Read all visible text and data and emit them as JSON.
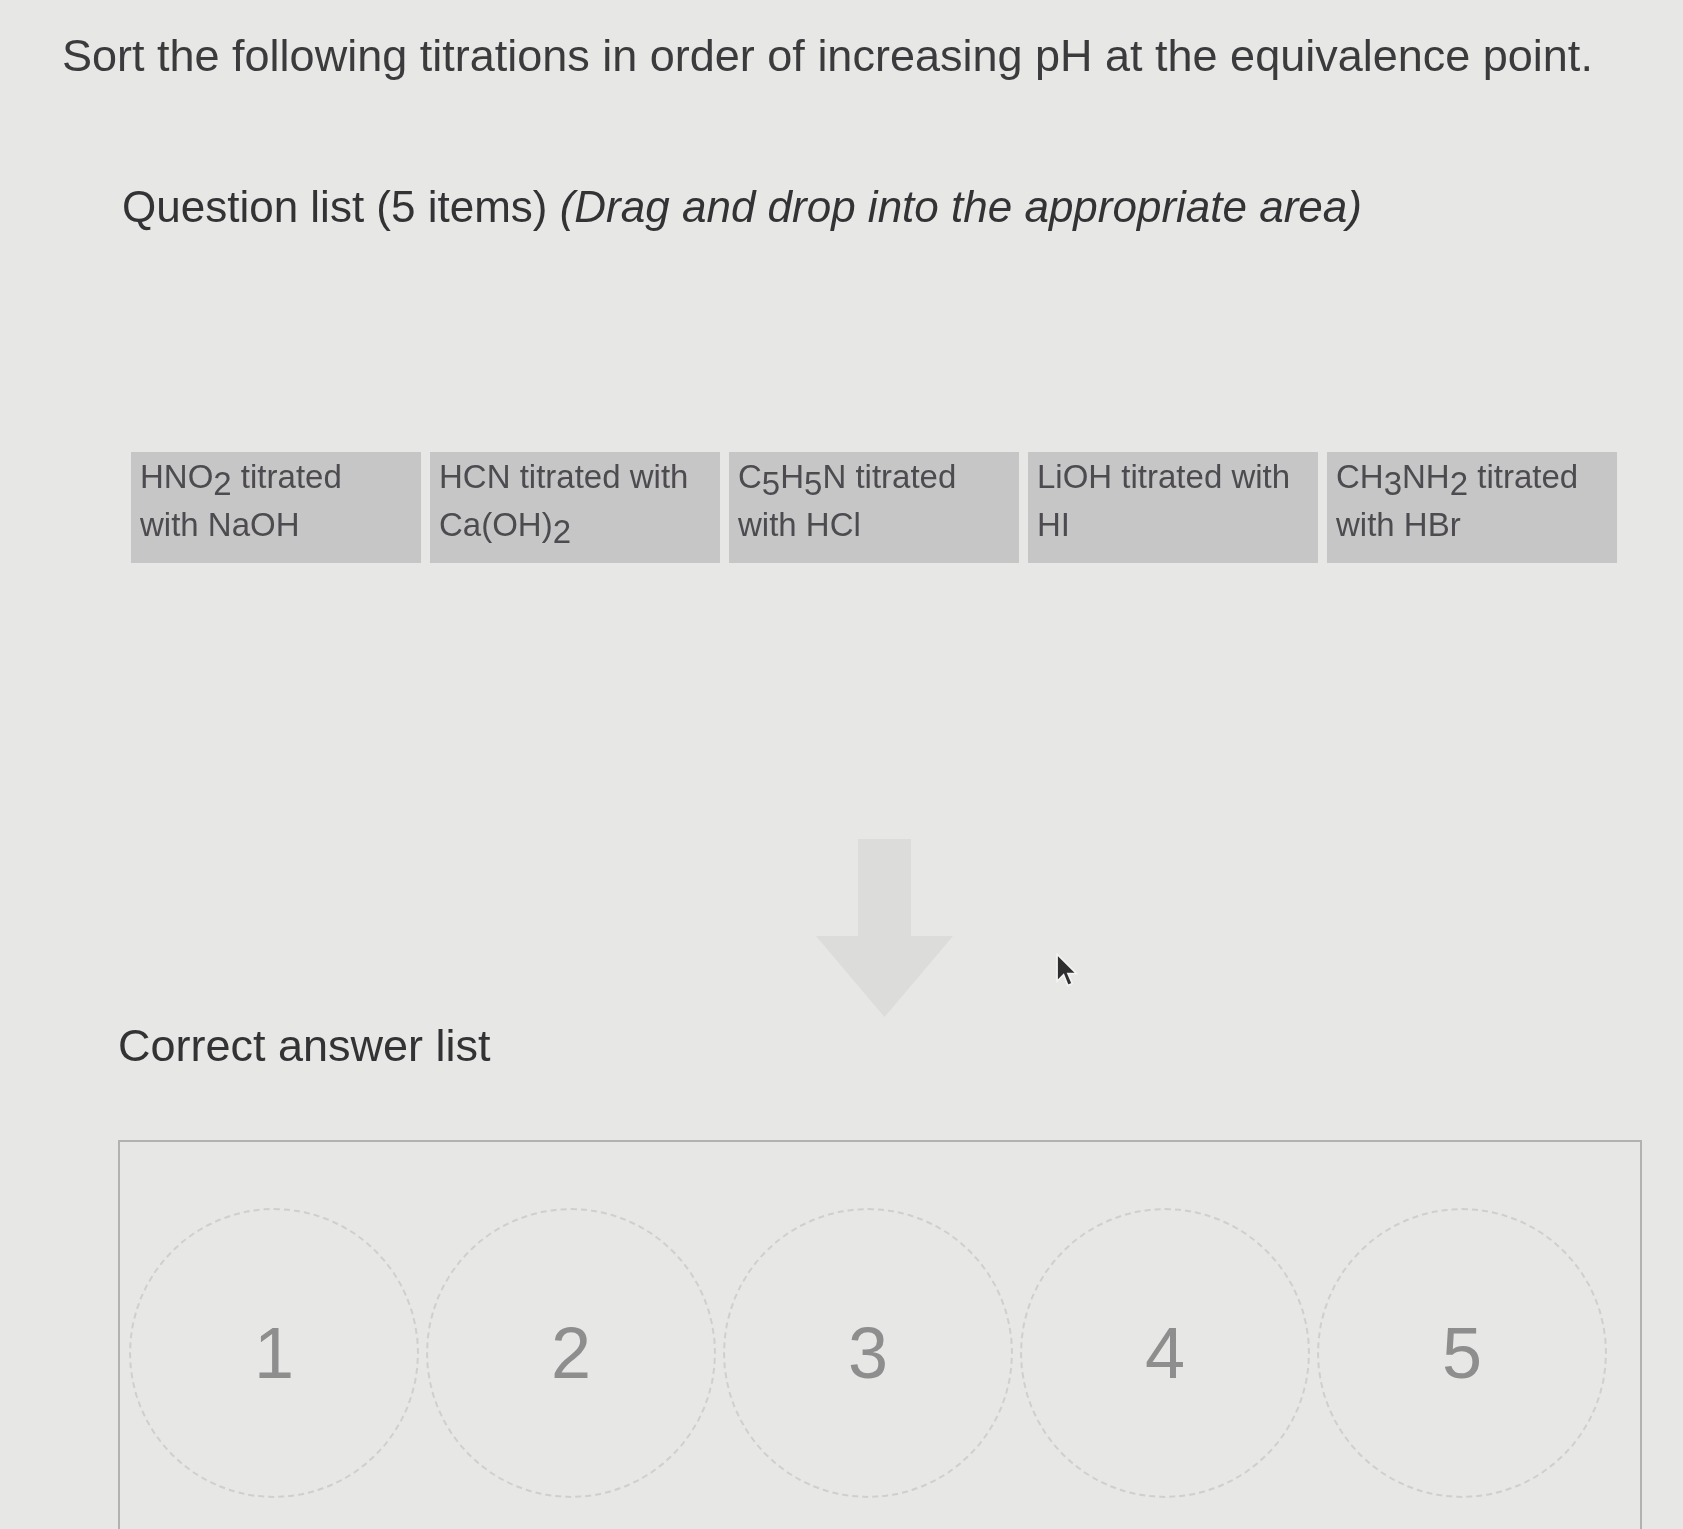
{
  "title": "Sort the following titrations in order of increasing pH at the equivalence point.",
  "question_list": {
    "heading": "Question list (5 items) *(Drag and drop into the appropriate area)*",
    "items": [
      "HNO$_{2}$ titrated with NaOH",
      "HCN titrated with Ca(OH)$_{2}$",
      "C$_{5}$H$_{5}$N titrated with HCl",
      "LiOH titrated with HI",
      "CH$_{3}$NH$_{2}$ titrated with HBr"
    ]
  },
  "answer_list": {
    "heading": "Correct answer list",
    "slots": [
      "1",
      "2",
      "3",
      "4",
      "5"
    ]
  }
}
